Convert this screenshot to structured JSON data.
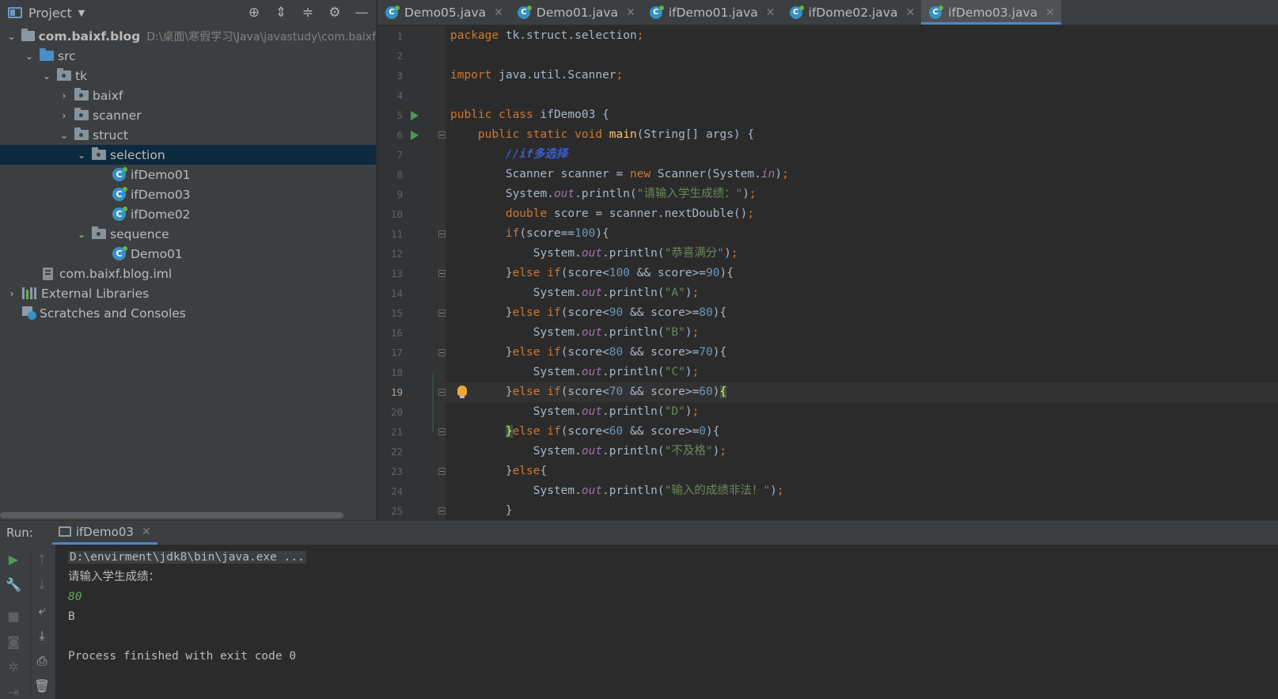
{
  "project_panel": {
    "title": "Project",
    "tree": [
      {
        "label": "com.baixf.blog",
        "path": "D:\\桌面\\寒假学习\\Java\\javastudy\\com.baixf"
      },
      {
        "label": "src"
      },
      {
        "label": "tk"
      },
      {
        "label": "baixf"
      },
      {
        "label": "scanner"
      },
      {
        "label": "struct"
      },
      {
        "label": "selection"
      },
      {
        "label": "ifDemo01"
      },
      {
        "label": "ifDemo03"
      },
      {
        "label": "ifDome02"
      },
      {
        "label": "sequence"
      },
      {
        "label": "Demo01"
      },
      {
        "label": "com.baixf.blog.iml"
      },
      {
        "label": "External Libraries"
      },
      {
        "label": "Scratches and Consoles"
      }
    ]
  },
  "tabs": [
    {
      "label": "Demo05.java"
    },
    {
      "label": "Demo01.java"
    },
    {
      "label": "ifDemo01.java"
    },
    {
      "label": "ifDome02.java"
    },
    {
      "label": "ifDemo03.java",
      "active": true
    }
  ],
  "editor": {
    "current_line": 19,
    "line_numbers": [
      "1",
      "2",
      "3",
      "4",
      "5",
      "6",
      "7",
      "8",
      "9",
      "10",
      "11",
      "12",
      "13",
      "14",
      "15",
      "16",
      "17",
      "18",
      "19",
      "20",
      "21",
      "22",
      "23",
      "24",
      "25"
    ]
  },
  "run_panel": {
    "label": "Run:",
    "tab_label": "ifDemo03",
    "console": [
      "D:\\envirment\\jdk8\\bin\\java.exe ...",
      "请输入学生成绩：",
      "80",
      "B",
      "",
      "Process finished with exit code 0"
    ]
  },
  "colors": {
    "keyword": "#cc7832",
    "string": "#6a8759",
    "number": "#6897bb",
    "field": "#9876aa",
    "method": "#ffc66d",
    "accent": "#4a88c7"
  }
}
